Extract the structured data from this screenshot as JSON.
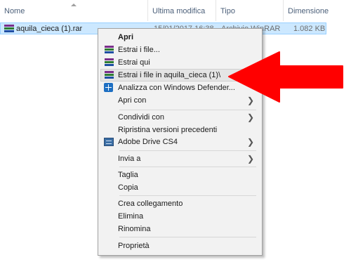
{
  "columns": {
    "name": "Nome",
    "modified": "Ultima modifica",
    "type": "Tipo",
    "size": "Dimensione"
  },
  "file": {
    "name": "aquila_cieca (1).rar",
    "modified": "15/01/2017 16:38",
    "type": "Archivio WinRAR",
    "size": "1.082 KB"
  },
  "menu": {
    "open": "Apri",
    "extract_files": "Estrai i file...",
    "extract_here": "Estrai qui",
    "extract_to": "Estrai i file in aquila_cieca (1)\\",
    "defender": "Analizza con Windows Defender...",
    "open_with": "Apri con",
    "share_with": "Condividi con",
    "restore_versions": "Ripristina versioni precedenti",
    "adobe_drive": "Adobe Drive CS4",
    "send_to": "Invia a",
    "cut": "Taglia",
    "copy": "Copia",
    "create_shortcut": "Crea collegamento",
    "delete": "Elimina",
    "rename": "Rinomina",
    "properties": "Proprietà"
  },
  "icons": {
    "rar": "winrar-books-icon",
    "defender": "windows-defender-icon",
    "adobe": "adobe-drive-icon",
    "submenu": "chevron-right-icon",
    "annotation": "red-arrow-icon"
  },
  "colors": {
    "selection": "#cce8ff",
    "menu_bg": "#f2f2f2",
    "highlight": "#e5e5e5",
    "arrow": "#ff0000"
  }
}
